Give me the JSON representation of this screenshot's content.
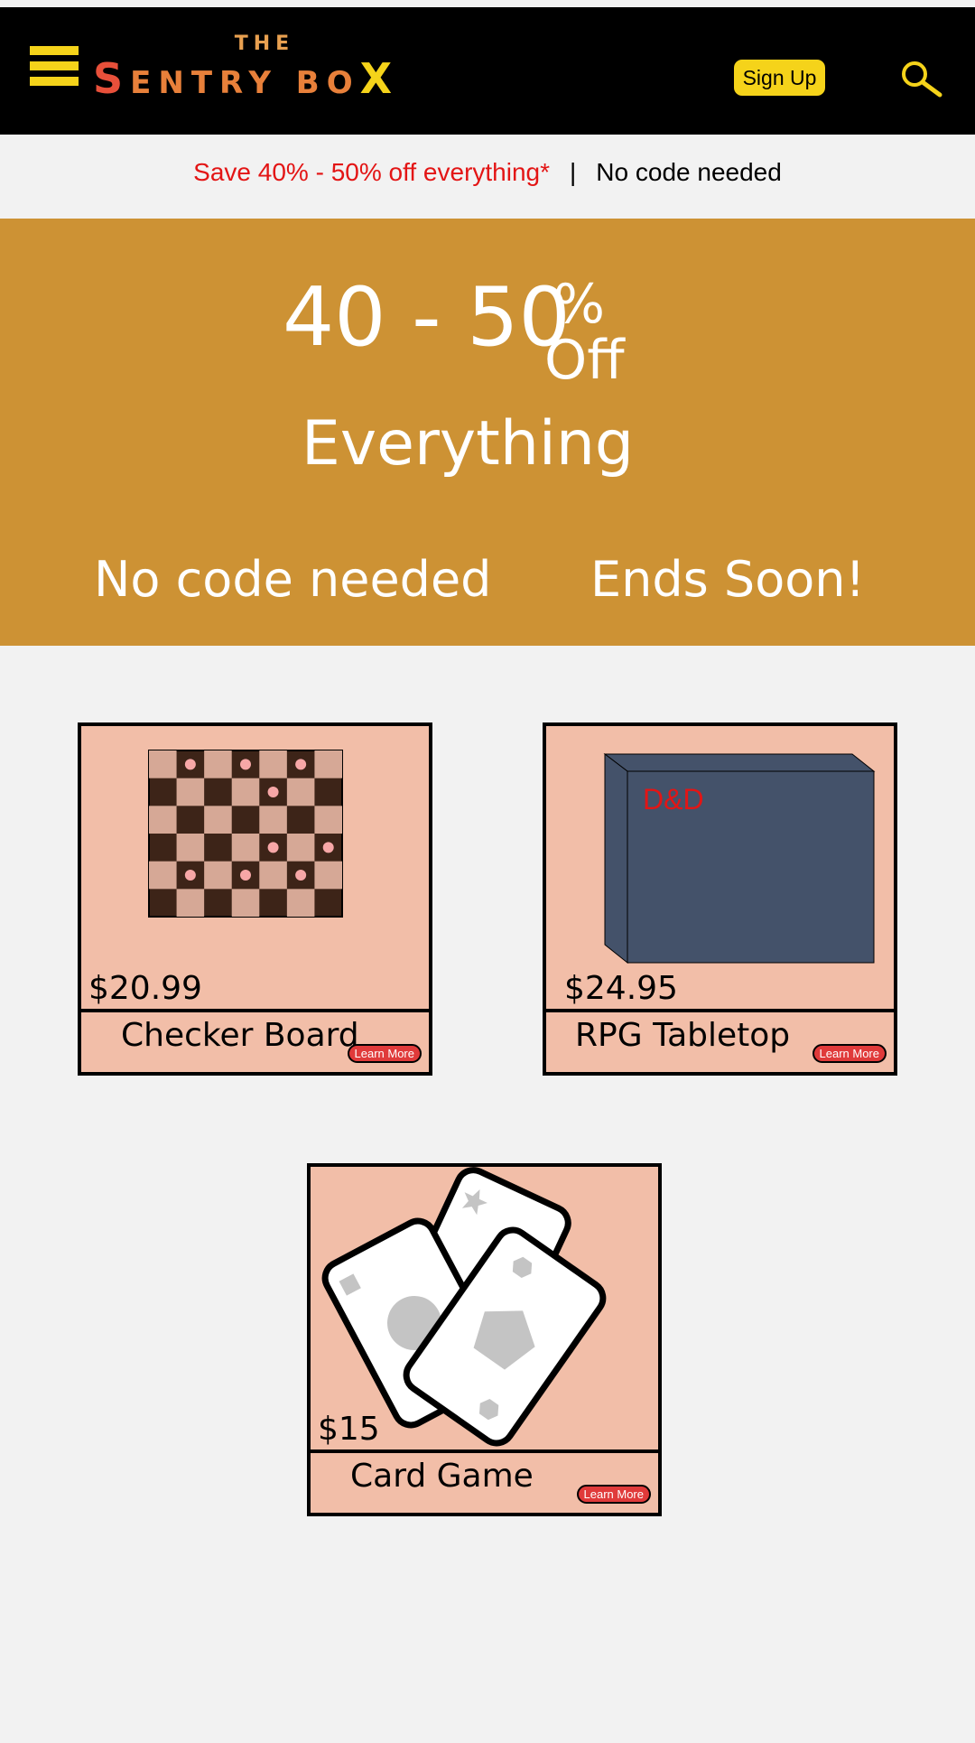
{
  "header": {
    "logo_the": "THE",
    "logo_first": "S",
    "logo_middle": "ENTRY BO",
    "logo_last": "X",
    "signup_label": "Sign Up"
  },
  "promo": {
    "offer": "Save 40% - 50% off everything*",
    "separator": "|",
    "note": "No code needed"
  },
  "hero": {
    "range": "40 - 50",
    "percent": "%",
    "off": "Off",
    "everything": "Everything",
    "no_code": "No code needed",
    "ends": "Ends Soon!",
    "background": "#cd9234"
  },
  "products": [
    {
      "price": "$20.99",
      "title": "Checker Board",
      "learn_more": "Learn More"
    },
    {
      "price": "$24.95",
      "title": "RPG Tabletop",
      "learn_more": "Learn More",
      "box_label": "D&D"
    },
    {
      "price": "$15",
      "title": "Card Game",
      "learn_more": "Learn More"
    }
  ],
  "colors": {
    "accent": "#f5d31a",
    "promo_red": "#e31515",
    "card_bg": "#f2bea8",
    "learn_more": "#e03a3a"
  }
}
